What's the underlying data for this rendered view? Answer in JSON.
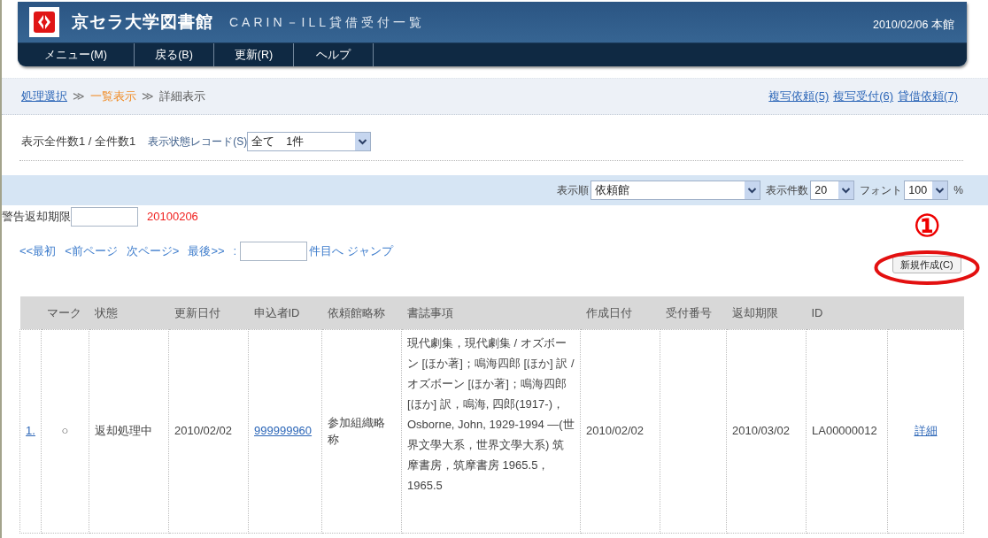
{
  "header": {
    "title": "京セラ大学図書館",
    "subtitle": "CARIN－ILL貸借受付一覧",
    "date_branch": "2010/02/06 本館",
    "menu": [
      "メニュー(M)",
      "戻る(B)",
      "更新(R)",
      "ヘルプ"
    ]
  },
  "breadcrumb": [
    {
      "kind": "link",
      "label": "処理選択"
    },
    {
      "kind": "separator",
      "label": "≫"
    },
    {
      "kind": "highlight",
      "label": "一覧表示"
    },
    {
      "kind": "separator",
      "label": "≫"
    },
    {
      "kind": "plain",
      "label": "詳細表示"
    }
  ],
  "quick_links": [
    "複写依頼(5)",
    "複写受付(6)",
    "貸借依頼(7)"
  ],
  "counts": {
    "summary": "表示全件数1 / 全件数1",
    "filter_label": "表示状態レコード(S)",
    "filter_value": "全て　1件"
  },
  "display_options": [
    {
      "kind": "sort",
      "label": "表示順",
      "value": "依頼館"
    },
    {
      "kind": "count",
      "label": "表示件数",
      "value": "20"
    },
    {
      "kind": "font",
      "label": "フォント",
      "value": "100",
      "suffix": "%"
    }
  ],
  "warning_due": {
    "label": "警告返却期限",
    "date": "20100206"
  },
  "pager": {
    "links": [
      "<<最初",
      "<前ページ",
      "次ページ>",
      "最後>>"
    ],
    "separator": ":",
    "jump_suffix": "件目へ",
    "jump_link": "ジャンプ"
  },
  "annotation": {
    "number": "①"
  },
  "new_button": "新規作成(C)",
  "table": {
    "columns": [
      "マーク",
      "状態",
      "更新日付",
      "申込者ID",
      "依頼館略称",
      "書誌事項",
      "作成日付",
      "受付番号",
      "返却期限",
      "ID"
    ],
    "rows": [
      {
        "number": "1.",
        "cells": [
          {
            "kind": "mark",
            "text": "○"
          },
          {
            "kind": "text",
            "text": "返却処理中"
          },
          {
            "kind": "text",
            "text": "2010/02/02"
          },
          {
            "kind": "link",
            "text": "999999960"
          },
          {
            "kind": "text",
            "text": "参加組織略称"
          },
          {
            "kind": "bib",
            "text": "現代劇集，現代劇集 / オズボーン [ほか著]；鳴海四郎 [ほか] 訳 / オズボーン [ほか著]；鳴海四郎 [ほか] 訳，鳴海, 四郎(1917-)，Osborne, John, 1929-1994 ―(世界文學大系，世界文學大系) 筑摩書房，筑摩書房 1965.5，1965.5"
          },
          {
            "kind": "text",
            "text": "2010/02/02"
          },
          {
            "kind": "blank"
          },
          {
            "kind": "text",
            "text": "2010/03/02"
          },
          {
            "kind": "text",
            "text": "LA00000012"
          }
        ],
        "detail": "詳細"
      }
    ]
  }
}
